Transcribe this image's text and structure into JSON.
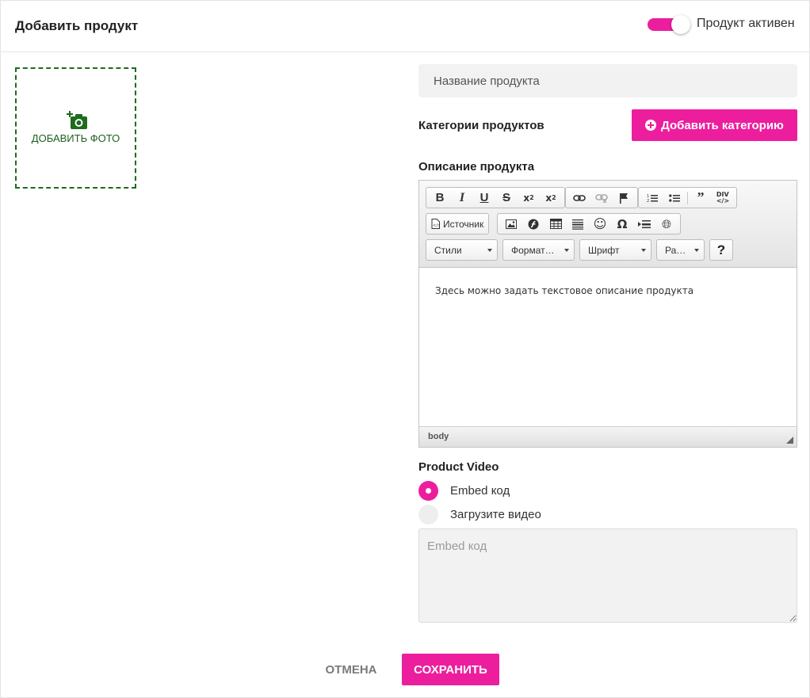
{
  "header": {
    "title": "Добавить продукт",
    "toggle_label": "Продукт активен",
    "toggle_on": true
  },
  "photo": {
    "label": "ДОБАВИТЬ ФОТО",
    "icon": "add-photo-icon"
  },
  "product_name": {
    "placeholder": "Название продукта",
    "value": ""
  },
  "categories": {
    "label": "Категории продуктов",
    "add_button": "Добавить категорию"
  },
  "description": {
    "label": "Описание продукта",
    "toolbar": {
      "row1": [
        "bold",
        "italic",
        "underline",
        "strike",
        "subscript",
        "superscript",
        "link",
        "unlink",
        "anchor",
        "numbered-list",
        "bulleted-list",
        "blockquote",
        "div"
      ],
      "source_label": "Источник",
      "row2": [
        "image",
        "flash",
        "table",
        "horizontal-line",
        "smiley",
        "special-char",
        "page-break",
        "iframe"
      ],
      "combos": [
        "Стили",
        "Формат…",
        "Шрифт",
        "Ра…"
      ],
      "help": "?"
    },
    "body_text": "Здесь можно задать текстовое описание продукта",
    "status_path": "body"
  },
  "video": {
    "label": "Product Video",
    "options": [
      {
        "label": "Embed код",
        "selected": true
      },
      {
        "label": "Загрузите видео",
        "selected": false
      }
    ],
    "embed_placeholder": "Embed код"
  },
  "actions": {
    "cancel": "Отмена",
    "save": "Сохранить"
  },
  "colors": {
    "accent": "#ec1e9e",
    "photo_border": "#1f6b1f"
  }
}
